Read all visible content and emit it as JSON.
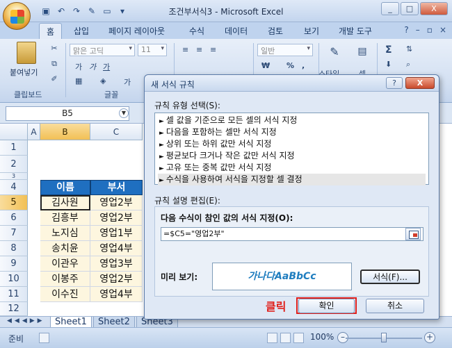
{
  "app": {
    "title": "조건부서식3 - Microsoft Excel",
    "window_controls": [
      "_",
      "□",
      "X"
    ]
  },
  "ribbon": {
    "tabs": [
      "홈",
      "삽입",
      "페이지 레이아웃",
      "수식",
      "데이터",
      "검토",
      "보기",
      "개발 도구"
    ],
    "active_tab": "홈",
    "clipboard_group": "클립보드",
    "paste_label": "붙여넣기",
    "font_group": "글꼴",
    "font_name": "맑은 고딕",
    "font_size": "11",
    "number_format": "일반",
    "currency_symbol": "₩ ",
    "percent": "%",
    "comma": ",",
    "style_btn": "스타일",
    "cell_btn": "셀",
    "sum_symbol": "Σ",
    "help_symbol": "?"
  },
  "formula_bar": {
    "name_box": "B5"
  },
  "sheet": {
    "columns": [
      "A",
      "B",
      "C"
    ],
    "rows": [
      "1",
      "2",
      "3",
      "4",
      "5",
      "6",
      "7",
      "8",
      "9",
      "10",
      "11",
      "12"
    ],
    "header_row": {
      "name": "이름",
      "dept": "부서"
    },
    "data": [
      {
        "name": "김사원",
        "dept": "영업2부"
      },
      {
        "name": "김흥부",
        "dept": "영업2부"
      },
      {
        "name": "노지심",
        "dept": "영업1부"
      },
      {
        "name": "송치윤",
        "dept": "영업4부"
      },
      {
        "name": "이관우",
        "dept": "영업3부"
      },
      {
        "name": "이봉주",
        "dept": "영업2부"
      },
      {
        "name": "이수진",
        "dept": "영업4부"
      }
    ],
    "tabs": [
      "Sheet1",
      "Sheet2",
      "Sheet3"
    ],
    "active_tab": "Sheet1"
  },
  "status_bar": {
    "status": "준비",
    "zoom": "100%"
  },
  "dialog": {
    "title": "새 서식 규칙",
    "help": "?",
    "close": "X",
    "rule_type_label": "규칙 유형 선택(S):",
    "rules": [
      "셀 값을 기준으로 모든 셀의 서식 지정",
      "다음을 포함하는 셀만 서식 지정",
      "상위 또는 하위 값만 서식 지정",
      "평균보다 크거나 작은 값만 서식 지정",
      "고유 또는 중복 값만 서식 지정",
      "수식을 사용하여 서식을 지정할 셀 결정"
    ],
    "selected_rule_index": 5,
    "edit_label": "규칙 설명 편집(E):",
    "formula_label": "다음 수식이 참인 값의 서식 지정(O):",
    "formula_value": "=$C5=\"영업2부\"",
    "preview_label": "미리 보기:",
    "preview_text": "가나다AaBbCc",
    "format_button": "서식(F)...",
    "ok_button": "확인",
    "cancel_button": "취소",
    "annotation": "클릭",
    "colors": {
      "annotation": "#e0201c",
      "header_fill": "#1f6fc0",
      "data_fill": "#fdf6df",
      "preview_text": "#1f7dbf"
    }
  }
}
